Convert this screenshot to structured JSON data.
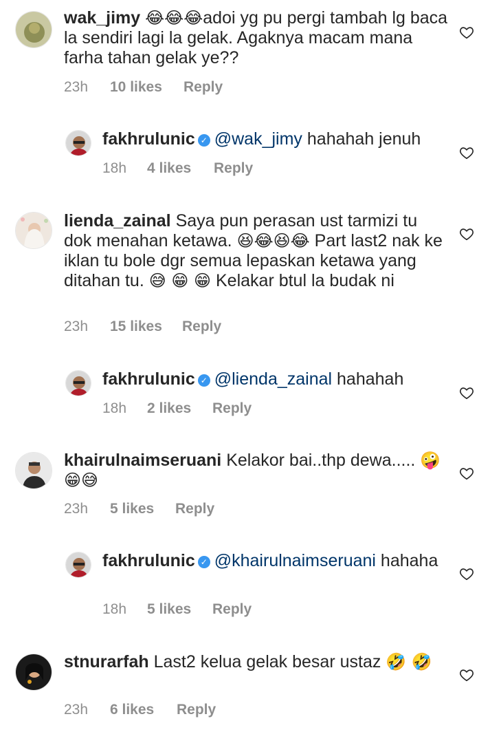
{
  "comments": [
    {
      "username": "wak_jimy",
      "pre_emoji": "😂😂😂",
      "text": "adoi yg pu pergi tambah lg baca la sendiri lagi la gelak. Agaknya macam mana farha tahan gelak ye??",
      "time": "23h",
      "likes": "10 likes",
      "reply": "Reply"
    },
    {
      "username": "fakhrulunic",
      "verified": "✓",
      "mention": "@wak_jimy",
      "text": "hahahah jenuh",
      "time": "18h",
      "likes": "4 likes",
      "reply": "Reply"
    },
    {
      "username": "lienda_zainal",
      "text1": "Saya pun perasan ust tarmizi tu dok menahan ketawa.",
      "emoji1": "😆😂😆😂",
      "text2": "Part last2 nak ke iklan tu bole dgr semua lepaskan ketawa yang ditahan tu.",
      "emoji2": "😅 😁 😁",
      "text3": "Kelakar btul la budak ni",
      "time": "23h",
      "likes": "15 likes",
      "reply": "Reply"
    },
    {
      "username": "fakhrulunic",
      "verified": "✓",
      "mention": "@lienda_zainal",
      "text": "hahahah",
      "time": "18h",
      "likes": "2 likes",
      "reply": "Reply"
    },
    {
      "username": "khairulnaimseruani",
      "text": "Kelakor bai..thp dewa.....",
      "emoji": "🤪😁😅",
      "time": "23h",
      "likes": "5 likes",
      "reply": "Reply"
    },
    {
      "username": "fakhrulunic",
      "verified": "✓",
      "mention": "@khairulnaimseruani",
      "text": "hahaha",
      "time": "18h",
      "likes": "5 likes",
      "reply": "Reply"
    },
    {
      "username": "stnurarfah",
      "text": "Last2 kelua gelak besar ustaz",
      "emoji": "🤣 🤣",
      "time": "23h",
      "likes": "6 likes",
      "reply": "Reply"
    }
  ],
  "colors": {
    "text": "#262626",
    "meta": "#8e8e8e",
    "mention": "#003569",
    "verified": "#3897f0"
  }
}
